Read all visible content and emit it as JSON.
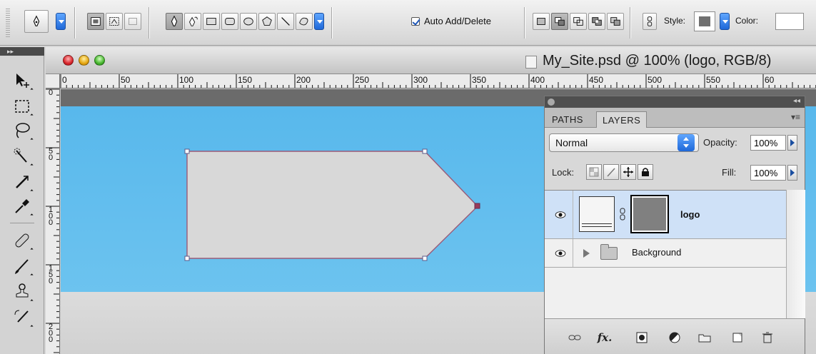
{
  "options_bar": {
    "auto_add_delete_label": "Auto Add/Delete",
    "auto_add_delete_checked": true,
    "style_label": "Style:",
    "color_label": "Color:"
  },
  "document": {
    "title": "My_Site.psd @ 100% (logo, RGB/8)",
    "ruler_h_labels": [
      "0",
      "50",
      "100",
      "150",
      "200",
      "250",
      "300",
      "350",
      "400",
      "450",
      "500",
      "550",
      "60"
    ],
    "ruler_v_labels": [
      "0",
      "50",
      "100",
      "150",
      "200"
    ]
  },
  "layers_panel": {
    "tabs": [
      "PATHS",
      "LAYERS"
    ],
    "active_tab": "LAYERS",
    "blend_mode": "Normal",
    "opacity_label": "Opacity:",
    "opacity_value": "100%",
    "lock_label": "Lock:",
    "fill_label": "Fill:",
    "fill_value": "100%",
    "layers": [
      {
        "name": "logo",
        "selected": true,
        "visible": true
      },
      {
        "name": "Background",
        "selected": false,
        "visible": true,
        "type": "group"
      }
    ]
  },
  "colors": {
    "canvas_blue": "#62bdee",
    "shape_fill": "#d8d8d8",
    "path_stroke": "#9a5a78",
    "selection_blue": "#cfe1f7"
  }
}
